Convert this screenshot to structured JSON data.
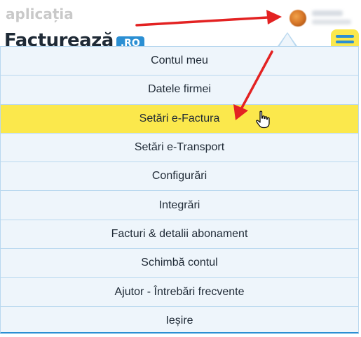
{
  "header": {
    "app_label": "aplicația",
    "brand_name": "Facturează",
    "brand_tld": ".RO"
  },
  "user": {
    "avatar_icon": "user-avatar",
    "name_blurred": true
  },
  "menu": {
    "toggle_icon": "hamburger-menu-icon",
    "items": [
      {
        "label": "Contul meu",
        "highlighted": false
      },
      {
        "label": "Datele firmei",
        "highlighted": false
      },
      {
        "label": "Setări e-Factura",
        "highlighted": true
      },
      {
        "label": "Setări e-Transport",
        "highlighted": false
      },
      {
        "label": "Configurări",
        "highlighted": false
      },
      {
        "label": "Integrări",
        "highlighted": false
      },
      {
        "label": "Facturi & detalii abonament",
        "highlighted": false
      },
      {
        "label": "Schimbă contul",
        "highlighted": false
      },
      {
        "label": "Ajutor - Întrebări frecvente",
        "highlighted": false
      },
      {
        "label": "Ieșire",
        "highlighted": false
      }
    ]
  },
  "colors": {
    "accent_yellow": "#fbe84c",
    "accent_blue": "#2b8fd3",
    "panel_bg": "#eef5fb",
    "annotation_red": "#e32222"
  }
}
